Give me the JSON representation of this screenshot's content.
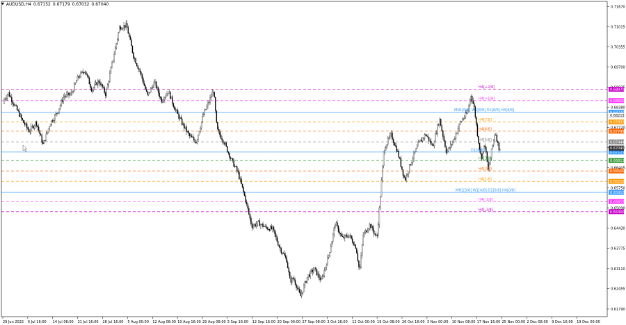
{
  "header": {
    "symbol": "AUDUSD,H4",
    "open": "0.67152",
    "high": "0.67179",
    "low": "0.67032",
    "close": "0.67040"
  },
  "chart_data": {
    "type": "candlestick",
    "symbol": "AUDUSD",
    "timeframe": "H4",
    "ylim": [
      0.6154,
      0.7184
    ],
    "y_ticks": [
      "0.71670",
      "0.71015",
      "0.70355",
      "0.69700",
      "0.69035",
      "0.68380",
      "0.67720",
      "0.67065",
      "0.66405",
      "0.65750",
      "0.65090",
      "0.64430",
      "0.63775",
      "0.63110",
      "0.62455",
      "0.61790",
      "0.61130",
      "0.60475",
      "0.59810",
      "0.59160",
      "0.58505",
      "0.57845"
    ],
    "y_tick_values": [
      0.7167,
      0.71015,
      0.70355,
      0.697,
      0.69035,
      0.6838,
      0.6772,
      0.67065,
      0.66405,
      0.6575,
      0.6509,
      0.6443,
      0.63775,
      0.6311,
      0.62455,
      0.6179,
      0.6113,
      0.60475,
      0.5981,
      0.5916,
      0.58505,
      0.57845
    ],
    "x_labels": [
      "29 Jun 2022",
      "6 Jul 16:00",
      "14 Jul 08:00",
      "21 Jul 16:00",
      "28 Jul 16:00",
      "5 Aug 00:00",
      "12 Aug 08:00",
      "19 Aug 16:00",
      "29 Aug 08:00",
      "5 Sep 16:00",
      "12 Sep 16:00",
      "20 Sep 00:00",
      "27 Sep 08:00",
      "3 Oct 16:00",
      "12 Oct 00:00",
      "19 Oct 08:00",
      "26 Oct 16:00",
      "3 Nov 00:00",
      "10 Nov 08:00",
      "17 Nov 16:00",
      "25 Nov 00:00",
      "2 Dec 08:00",
      "9 Dec 16:00",
      "19 Dec 00:00"
    ],
    "price_path": [
      [
        0,
        0.685
      ],
      [
        10,
        0.6885
      ],
      [
        20,
        0.684
      ],
      [
        30,
        0.6795
      ],
      [
        40,
        0.676
      ],
      [
        50,
        0.679
      ],
      [
        60,
        0.6715
      ],
      [
        70,
        0.6785
      ],
      [
        80,
        0.682
      ],
      [
        90,
        0.6875
      ],
      [
        100,
        0.688
      ],
      [
        110,
        0.6935
      ],
      [
        120,
        0.696
      ],
      [
        130,
        0.6895
      ],
      [
        140,
        0.6925
      ],
      [
        150,
        0.688
      ],
      [
        160,
        0.699
      ],
      [
        170,
        0.71
      ],
      [
        180,
        0.7105
      ],
      [
        190,
        0.7005
      ],
      [
        200,
        0.695
      ],
      [
        210,
        0.6875
      ],
      [
        220,
        0.692
      ],
      [
        230,
        0.686
      ],
      [
        240,
        0.689
      ],
      [
        250,
        0.683
      ],
      [
        260,
        0.6785
      ],
      [
        270,
        0.6745
      ],
      [
        280,
        0.6725
      ],
      [
        290,
        0.681
      ],
      [
        300,
        0.6865
      ],
      [
        305,
        0.6895
      ],
      [
        310,
        0.6765
      ],
      [
        320,
        0.6725
      ],
      [
        330,
        0.667
      ],
      [
        340,
        0.6625
      ],
      [
        350,
        0.6545
      ],
      [
        360,
        0.645
      ],
      [
        370,
        0.646
      ],
      [
        380,
        0.6445
      ],
      [
        390,
        0.644
      ],
      [
        400,
        0.638
      ],
      [
        410,
        0.634
      ],
      [
        415,
        0.627
      ],
      [
        420,
        0.628
      ],
      [
        430,
        0.622
      ],
      [
        440,
        0.6285
      ],
      [
        450,
        0.631
      ],
      [
        460,
        0.627
      ],
      [
        470,
        0.635
      ],
      [
        475,
        0.64
      ],
      [
        480,
        0.646
      ],
      [
        490,
        0.641
      ],
      [
        500,
        0.642
      ],
      [
        510,
        0.638
      ],
      [
        515,
        0.63
      ],
      [
        520,
        0.642
      ],
      [
        530,
        0.6455
      ],
      [
        540,
        0.641
      ],
      [
        545,
        0.655
      ],
      [
        550,
        0.67
      ],
      [
        560,
        0.675
      ],
      [
        570,
        0.669
      ],
      [
        580,
        0.66
      ],
      [
        590,
        0.6665
      ],
      [
        600,
        0.672
      ],
      [
        610,
        0.675
      ],
      [
        620,
        0.671
      ],
      [
        630,
        0.68
      ],
      [
        640,
        0.669
      ],
      [
        650,
        0.673
      ],
      [
        660,
        0.679
      ],
      [
        670,
        0.682
      ],
      [
        675,
        0.688
      ],
      [
        680,
        0.6835
      ],
      [
        685,
        0.674
      ],
      [
        690,
        0.667
      ],
      [
        695,
        0.672
      ],
      [
        700,
        0.663
      ],
      [
        705,
        0.67
      ],
      [
        710,
        0.676
      ],
      [
        715,
        0.6705
      ]
    ],
    "levels": [
      {
        "label": "H4[+2/8]",
        "price_label": "0.68970",
        "value": 0.6897,
        "color": "#cc00cc",
        "style": "dashed",
        "show_label": true
      },
      {
        "label": "H4[+1/8]",
        "price_label": "0.68600",
        "value": 0.686,
        "color": "#ff33ff",
        "style": "dashed",
        "show_label": true
      },
      {
        "label": "MN1[R/8] W1[8/8] D1[8/8] H4[8/8]",
        "price_label": "0.68220",
        "value": 0.6822,
        "color": "#3399ff",
        "style": "solid",
        "show_label": true
      },
      {
        "label": "H4[7/8]",
        "price_label": "0.67850",
        "value": 0.679,
        "color": "#ff9900",
        "style": "dashed",
        "show_label": true
      },
      {
        "label": "H4[6/8]",
        "price_label": "0.67745",
        "value": 0.676,
        "color": "#ff6600",
        "style": "dashed",
        "show_label": true
      },
      {
        "label": "H4[5/8]",
        "price_label": "0.67444",
        "value": 0.6725,
        "color": "#888888",
        "style": "dashed",
        "show_label": true
      },
      {
        "label": "D1[4/8]",
        "price_label": "0.67125",
        "value": 0.6692,
        "color": "#3399ff",
        "style": "solid",
        "show_label": true
      },
      {
        "label": "H4[3/8]",
        "price_label": "0.66813",
        "value": 0.6664,
        "color": "#339933",
        "style": "dashed",
        "show_label": true
      },
      {
        "label": "H4[2/8]",
        "price_label": "0.66500",
        "value": 0.663,
        "color": "#ff6600",
        "style": "dashed",
        "show_label": true
      },
      {
        "label": "H4[1/8]",
        "price_label": "0.66215",
        "value": 0.6596,
        "color": "#ff9900",
        "style": "dashed",
        "show_label": true
      },
      {
        "label": "MN1[3/8] W1[4/8] D1[0/8] H4[0/8]",
        "price_label": "0.65910",
        "value": 0.656,
        "color": "#3399ff",
        "style": "solid",
        "show_label": true
      },
      {
        "label": "H4[-1/8]",
        "price_label": "0.65615",
        "value": 0.653,
        "color": "#ff33ff",
        "style": "dashed",
        "show_label": true
      },
      {
        "label": "H4[-2/8]",
        "price_label": "0.65300",
        "value": 0.6497,
        "color": "#cc00cc",
        "style": "dashed",
        "show_label": true
      }
    ],
    "extra_axis_badges": [
      {
        "price_label": "0.67600",
        "value": 0.6702,
        "color": "#1f6fbf"
      },
      {
        "price_label": "0.68215",
        "value": 0.6812,
        "color": "#ffffff"
      }
    ],
    "current_price": {
      "price_label": "0.67040",
      "value": 0.6705,
      "color": "#333333"
    },
    "grid": false,
    "background": "#ffffff",
    "candle_color": "#000000"
  }
}
